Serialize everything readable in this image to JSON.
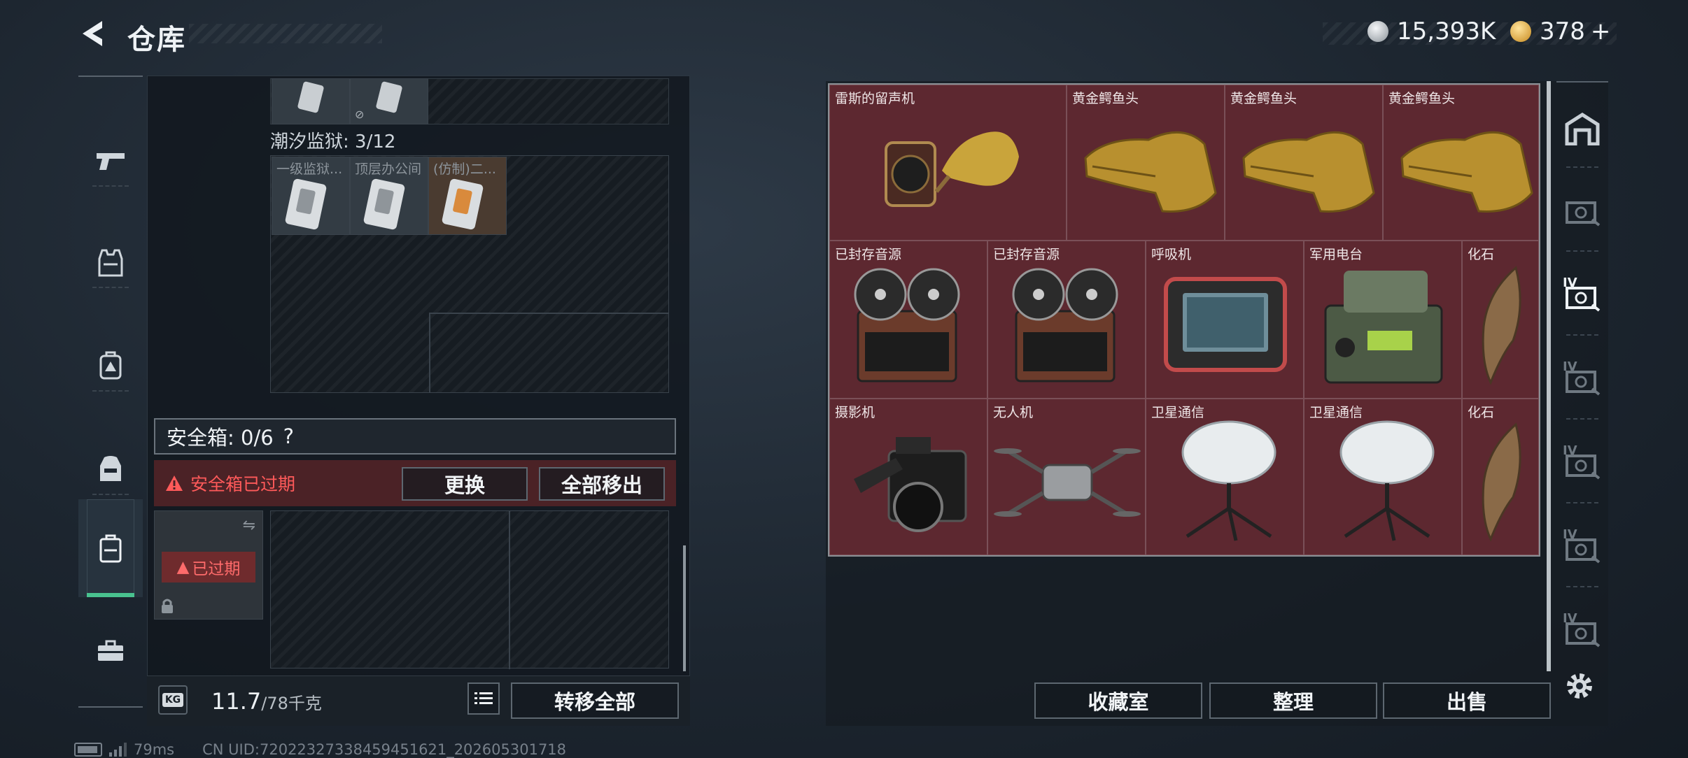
{
  "header": {
    "title": "仓库",
    "currency_1": "15,393K",
    "currency_2": "378",
    "plus": "+"
  },
  "left_panel": {
    "prison_label": "潮汐监狱: 3/12",
    "prison_items": [
      "一级监狱...",
      "顶层办公间",
      "(仿制)二..."
    ],
    "safe_box_label": "安全箱: 0/6",
    "safe_box_help": "?",
    "expired_warning": "安全箱已过期",
    "replace_button": "更换",
    "move_all_out_button": "全部移出",
    "safe_item_tag": "已过期",
    "weight_value": "11.7",
    "weight_max": "/78千克",
    "weight_icon_text": "KG",
    "transfer_all_button": "转移全部"
  },
  "grid_items": [
    {
      "name": "雷斯的留声机",
      "icon": "gramophone-icon"
    },
    {
      "name": "黄金鳄鱼头",
      "icon": "gold-croc-head-icon"
    },
    {
      "name": "黄金鳄鱼头",
      "icon": "gold-croc-head-icon"
    },
    {
      "name": "黄金鳄鱼头",
      "icon": "gold-croc-head-icon"
    },
    {
      "name": "已封存音源",
      "icon": "reel-recorder-icon"
    },
    {
      "name": "已封存音源",
      "icon": "reel-recorder-icon"
    },
    {
      "name": "呼吸机",
      "icon": "ventilator-icon"
    },
    {
      "name": "军用电台",
      "icon": "military-radio-icon"
    },
    {
      "name": "化石",
      "icon": "fossil-claw-icon"
    },
    {
      "name": "摄影机",
      "icon": "camera-icon"
    },
    {
      "name": "无人机",
      "icon": "drone-icon"
    },
    {
      "name": "卫星通信",
      "icon": "satellite-dish-icon"
    },
    {
      "name": "卫星通信",
      "icon": "satellite-dish-icon"
    },
    {
      "name": "化石",
      "icon": "fossil-claw-icon"
    }
  ],
  "right_panel": {
    "collection_button": "收藏室",
    "organize_button": "整理",
    "sell_button": "出售",
    "tier_labels": [
      "IV",
      "IV",
      "IV",
      "IV",
      "IV",
      "IV"
    ]
  },
  "footer": {
    "ping": "79ms",
    "uid": "CN UID:72022327338459451621_202605301718"
  },
  "colors": {
    "grid_bg": "#5d2830",
    "accent_green": "#49c28f",
    "warning_red": "#ff5a5a"
  }
}
